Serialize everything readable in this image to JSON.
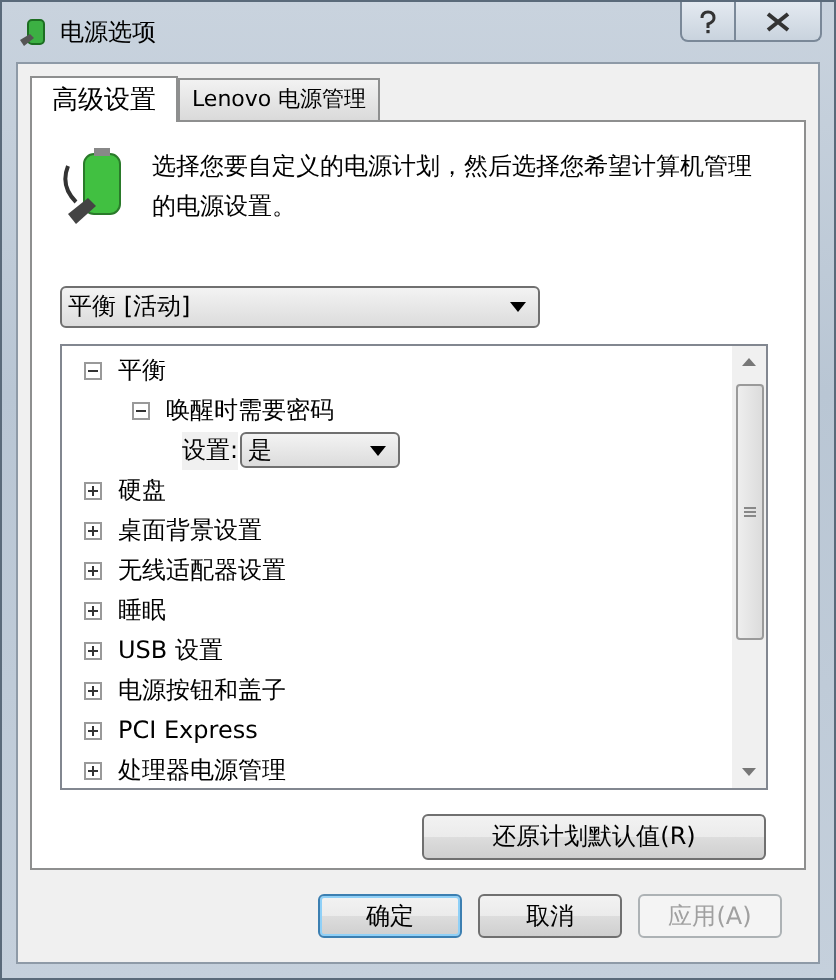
{
  "window": {
    "title": "电源选项"
  },
  "tabs": [
    {
      "label": "高级设置",
      "selected": true
    },
    {
      "label": "Lenovo 电源管理",
      "selected": false
    }
  ],
  "description": "选择您要自定义的电源计划，然后选择您希望计算机管理的电源设置。",
  "plan_select": {
    "value": "平衡 [活动]"
  },
  "tree": [
    {
      "label": "平衡",
      "expanded": true,
      "children": [
        {
          "label": "唤醒时需要密码",
          "expanded": true,
          "setting": {
            "label": "设置:",
            "value": "是"
          }
        }
      ]
    },
    {
      "label": "硬盘",
      "expanded": false
    },
    {
      "label": "桌面背景设置",
      "expanded": false
    },
    {
      "label": "无线适配器设置",
      "expanded": false
    },
    {
      "label": "睡眠",
      "expanded": false
    },
    {
      "label": "USB 设置",
      "expanded": false
    },
    {
      "label": "电源按钮和盖子",
      "expanded": false
    },
    {
      "label": "PCI Express",
      "expanded": false
    },
    {
      "label": "处理器电源管理",
      "expanded": false
    }
  ],
  "restore_button": "还原计划默认值(R)",
  "buttons": [
    {
      "label": "确定",
      "disabled": false,
      "default": true
    },
    {
      "label": "取消",
      "disabled": false,
      "default": false
    },
    {
      "label": "应用(A)",
      "disabled": true,
      "default": false
    }
  ]
}
